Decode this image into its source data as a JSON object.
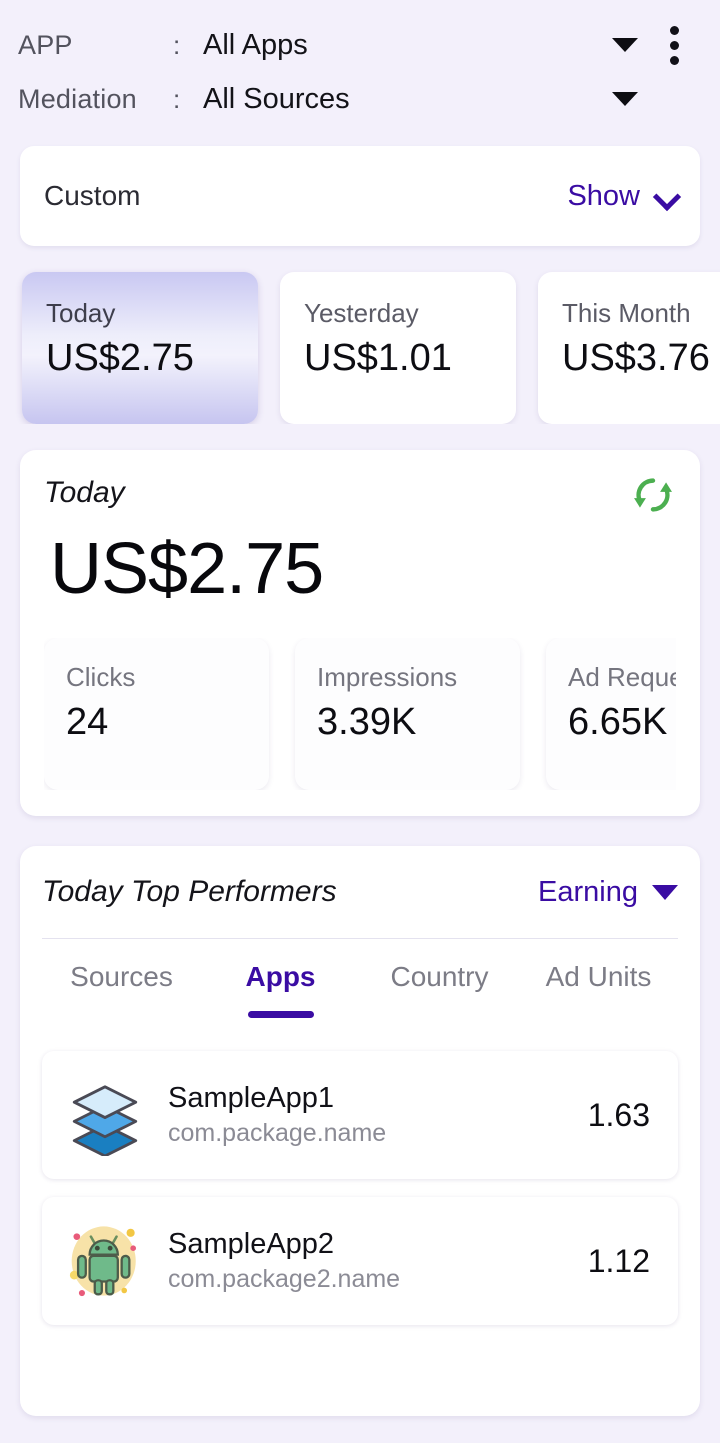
{
  "filters": {
    "app": {
      "key": "APP",
      "separator": ":",
      "value": "All Apps"
    },
    "mediation": {
      "key": "Mediation",
      "separator": ":",
      "value": "All Sources"
    },
    "overflow_icon": "kebab-menu-icon"
  },
  "date_range": {
    "label": "Custom",
    "toggle_label": "Show",
    "toggle_icon": "chevron-down-icon"
  },
  "summary_tiles": [
    {
      "label": "Today",
      "value": "US$2.75",
      "selected": true
    },
    {
      "label": "Yesterday",
      "value": "US$1.01",
      "selected": false
    },
    {
      "label": "This Month",
      "value": "US$3.76",
      "selected": false
    }
  ],
  "today_card": {
    "title": "Today",
    "amount": "US$2.75",
    "refresh_icon": "sync-refresh-icon",
    "metrics": [
      {
        "label": "Clicks",
        "value": "24"
      },
      {
        "label": "Impressions",
        "value": "3.39K"
      },
      {
        "label": "Ad Requests",
        "value": "6.65K"
      }
    ]
  },
  "top_performers": {
    "title": "Today Top Performers",
    "sort_label": "Earning",
    "sort_icon": "caret-down-icon",
    "tabs": [
      {
        "label": "Sources",
        "active": false
      },
      {
        "label": "Apps",
        "active": true
      },
      {
        "label": "Country",
        "active": false
      },
      {
        "label": "Ad Units",
        "active": false
      }
    ],
    "rows": [
      {
        "name": "SampleApp1",
        "package": "com.package.name",
        "value": "1.63",
        "icon": "layers-stack-icon"
      },
      {
        "name": "SampleApp2",
        "package": "com.package2.name",
        "value": "1.12",
        "icon": "android-robot-icon"
      }
    ]
  },
  "colors": {
    "background": "#f3f0fb",
    "accent_purple": "#3a0ca3",
    "refresh_green": "#4caf50",
    "card_white": "#ffffff"
  }
}
